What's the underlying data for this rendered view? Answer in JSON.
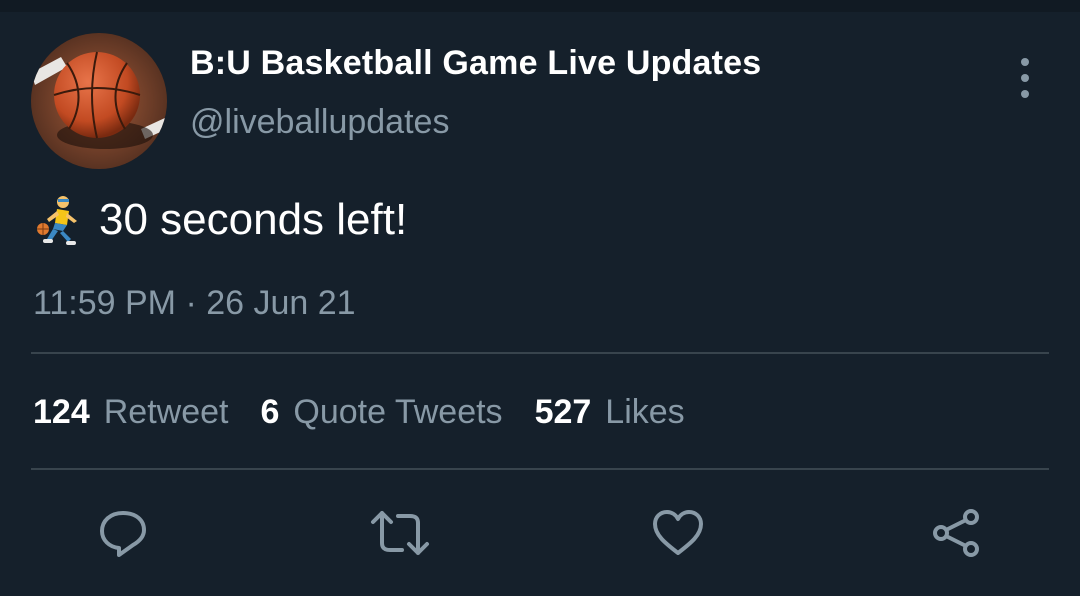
{
  "author": {
    "display_name": "B:U Basketball Game Live Updates",
    "handle": "@liveballupdates",
    "avatar_icon": "basketball-avatar"
  },
  "tweet": {
    "emoji_icon": "person-bouncing-ball-icon",
    "text": "30 seconds left!",
    "timestamp": "11:59 PM · 26 Jun 21"
  },
  "stats": [
    {
      "count": "124",
      "label": "Retweet"
    },
    {
      "count": "6",
      "label": "Quote Tweets"
    },
    {
      "count": "527",
      "label": "Likes"
    }
  ],
  "actions": [
    {
      "icon": "reply-icon"
    },
    {
      "icon": "retweet-icon"
    },
    {
      "icon": "like-icon"
    },
    {
      "icon": "share-icon"
    }
  ],
  "colors": {
    "background": "#15202b",
    "secondary_text": "#8899a6",
    "divider": "#38444d"
  }
}
